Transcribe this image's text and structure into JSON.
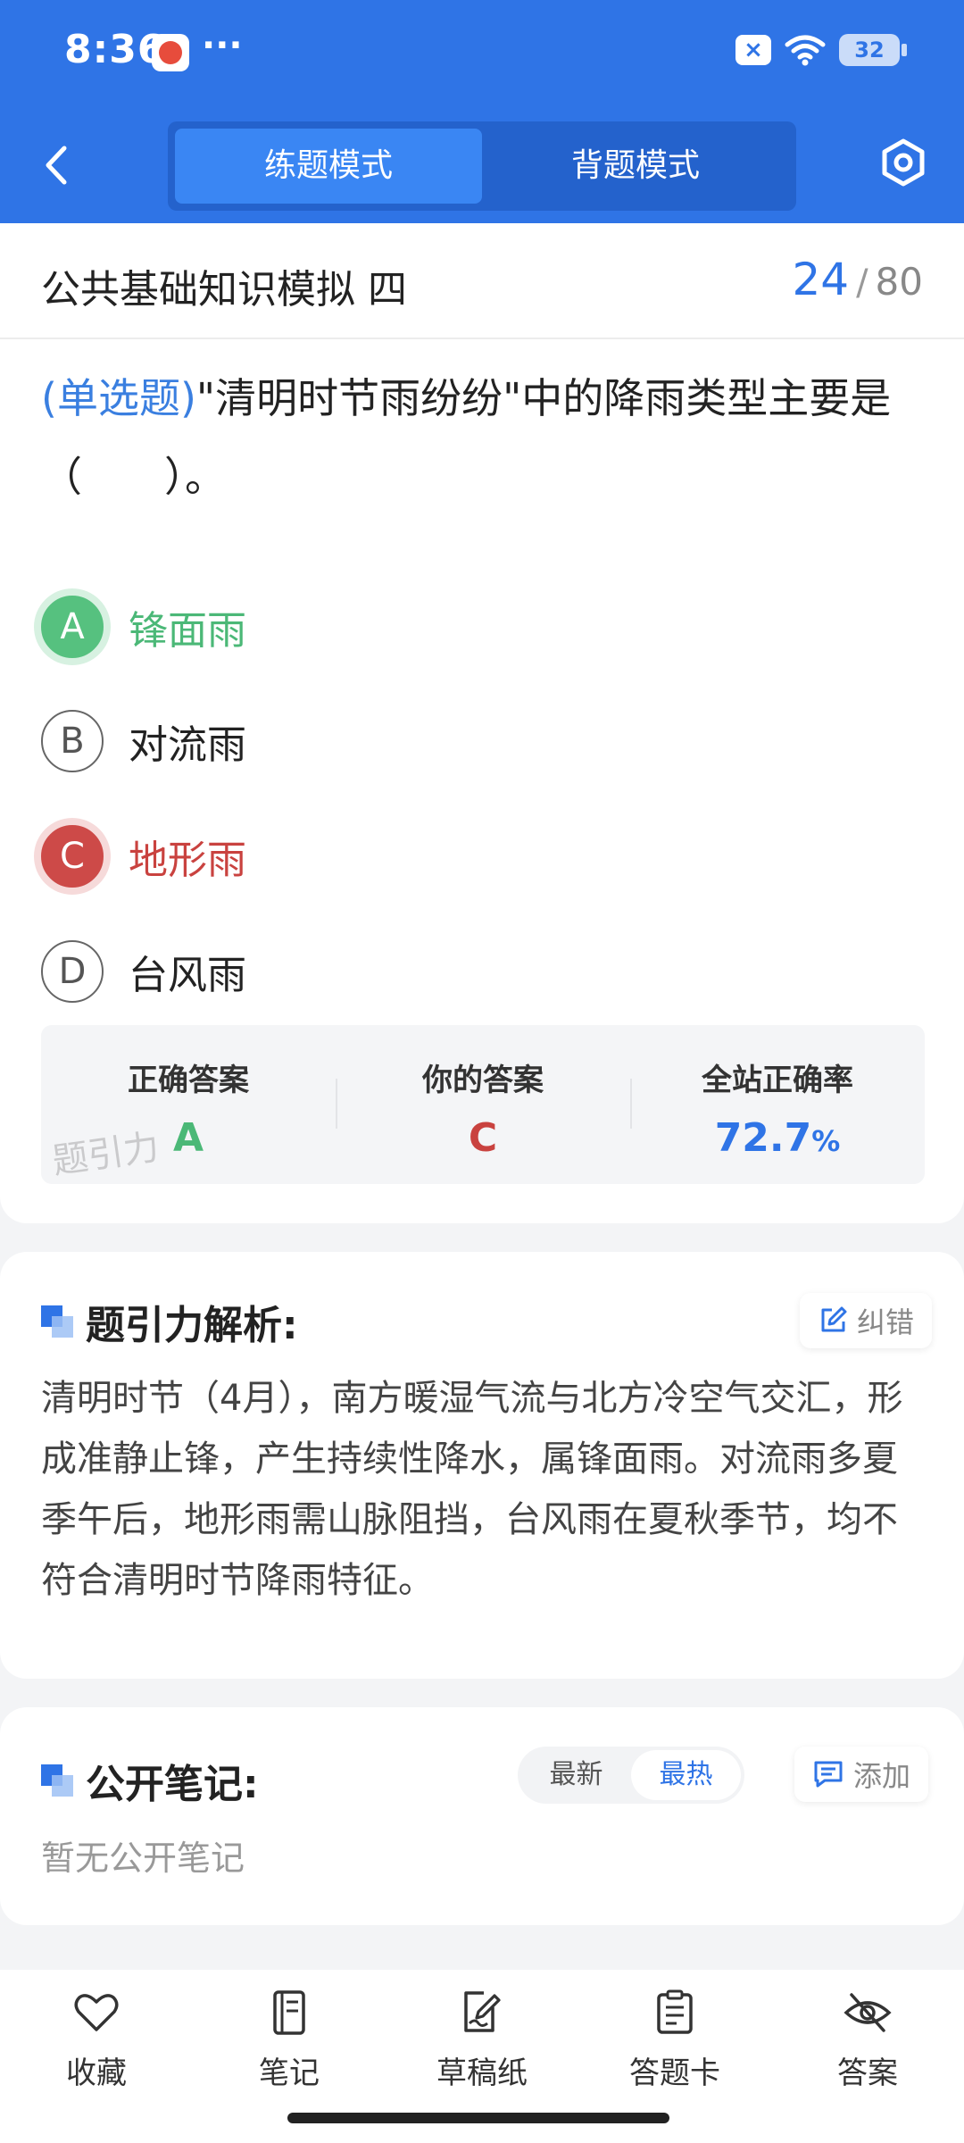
{
  "status": {
    "time": "8:36",
    "dots": "···",
    "battery": "32"
  },
  "header": {
    "modes": [
      "练题模式",
      "背题模式"
    ],
    "active_mode": "练题模式"
  },
  "exam": {
    "title": "公共基础知识模拟 四",
    "current": "24",
    "separator": "/",
    "total": "80"
  },
  "question": {
    "type": "(单选题)",
    "text": "\"清明时节雨纷纷\"中的降雨类型主要是（　　）。",
    "options": [
      {
        "letter": "A",
        "text": "锋面雨",
        "state": "correct"
      },
      {
        "letter": "B",
        "text": "对流雨",
        "state": "normal"
      },
      {
        "letter": "C",
        "text": "地形雨",
        "state": "wrong"
      },
      {
        "letter": "D",
        "text": "台风雨",
        "state": "normal"
      }
    ]
  },
  "answer_summary": {
    "correct_label": "正确答案",
    "correct_value": "A",
    "yours_label": "你的答案",
    "yours_value": "C",
    "rate_label": "全站正确率",
    "rate_value": "72.7",
    "rate_unit": "%",
    "watermark": "题引力"
  },
  "analysis": {
    "title": "题引力解析:",
    "report_label": "纠错",
    "text": "清明时节（4月），南方暖湿气流与北方冷空气交汇，形成准静止锋，产生持续性降水，属锋面雨。对流雨多夏季午后，地形雨需山脉阻挡，台风雨在夏秋季节，均不符合清明时节降雨特征。"
  },
  "notes": {
    "title": "公开笔记:",
    "sort_latest": "最新",
    "sort_hot": "最热",
    "add_label": "添加",
    "empty_text": "暂无公开笔记"
  },
  "tabbar": {
    "items": [
      {
        "label": "收藏",
        "icon": "heart-icon"
      },
      {
        "label": "笔记",
        "icon": "notebook-icon"
      },
      {
        "label": "草稿纸",
        "icon": "draft-icon"
      },
      {
        "label": "答题卡",
        "icon": "answer-card-icon"
      },
      {
        "label": "答案",
        "icon": "eye-off-icon"
      }
    ]
  },
  "colors": {
    "brand": "#2f74e6",
    "correct": "#4bb877",
    "wrong": "#c9423f"
  }
}
